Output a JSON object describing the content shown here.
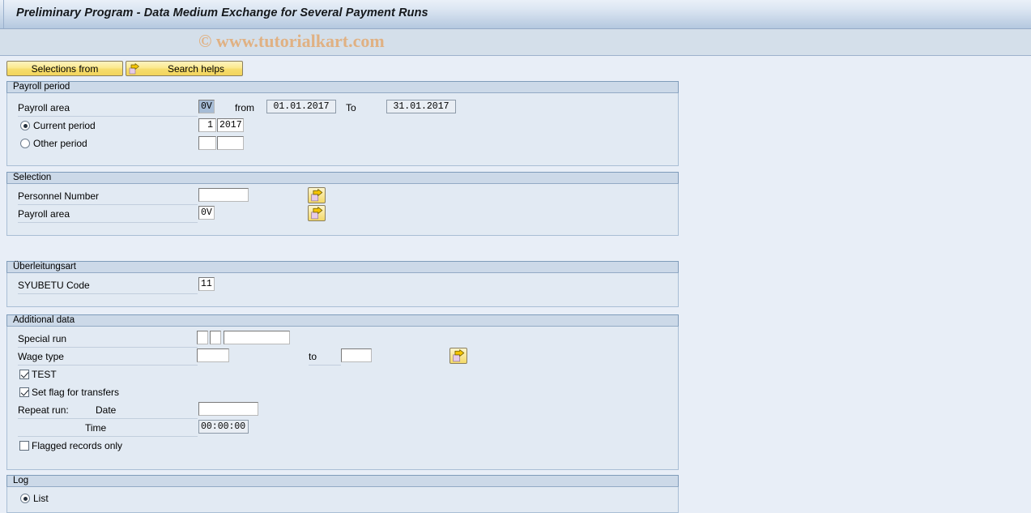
{
  "window": {
    "title": "Preliminary Program - Data Medium Exchange for Several Payment Runs",
    "watermark": "© www.tutorialkart.com"
  },
  "toolbar": {
    "selections_from_label": "Selections from",
    "search_helps_label": "Search helps",
    "search_helps_icon": "arrow-right-icon"
  },
  "payroll_period": {
    "panel_title": "Payroll period",
    "payroll_area_label": "Payroll area",
    "payroll_area_value": "0V",
    "from_label": "from",
    "from_value": "01.01.2017",
    "to_label": "To",
    "to_value": "31.01.2017",
    "current_period_label": "Current period",
    "current_period_selected": true,
    "current_period_num": "1",
    "current_period_year": "2017",
    "other_period_label": "Other period",
    "other_period_selected": false,
    "other_period_num": "",
    "other_period_year": ""
  },
  "selection": {
    "panel_title": "Selection",
    "personnel_number_label": "Personnel Number",
    "personnel_number_value": "",
    "payroll_area_label": "Payroll area",
    "payroll_area_value": "0V",
    "multi_select_icon": "arrow-right-icon"
  },
  "transfer_type": {
    "panel_title": "Überleitungsart",
    "syubetu_label": "SYUBETU Code",
    "syubetu_value": "11"
  },
  "additional_data": {
    "panel_title": "Additional data",
    "special_run_label": "Special run",
    "special_run_a": "",
    "special_run_b": "",
    "special_run_text": "",
    "wage_type_label": "Wage type",
    "wage_type_from": "",
    "wage_type_to_label": "to",
    "wage_type_to": "",
    "test_label": "TEST",
    "test_checked": true,
    "set_flag_label": "Set flag for transfers",
    "set_flag_checked": true,
    "repeat_run_label": "Repeat run:",
    "date_label": "Date",
    "date_value": "",
    "time_label": "Time",
    "time_value": "00:00:00",
    "flagged_records_label": "Flagged records only",
    "flagged_records_checked": false,
    "multi_select_icon": "arrow-right-icon"
  },
  "log": {
    "panel_title": "Log",
    "list_label": "List",
    "list_selected": true
  },
  "colors": {
    "page_background": "#e8eef7",
    "panel_background": "#e2eaf3",
    "panel_header": "#ccd9e8",
    "button_accent": "#f6dd6d",
    "title_gradient_end": "#b4c8df",
    "watermark": "#e0b183",
    "field_selected": "#a6bcd6"
  }
}
